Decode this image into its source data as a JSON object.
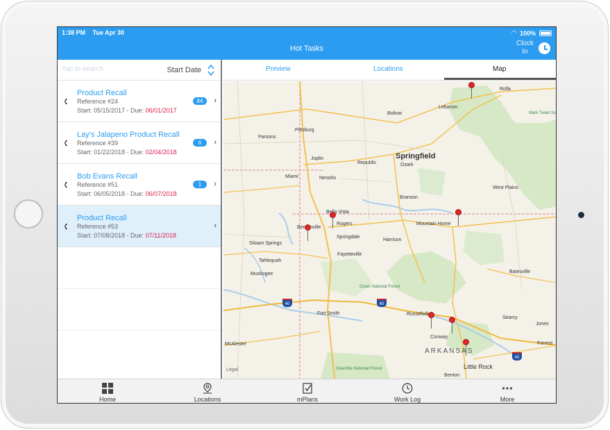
{
  "status_bar": {
    "time": "1:38 PM",
    "date": "Tue Apr 30",
    "battery": "100%"
  },
  "header": {
    "title": "Hot Tasks",
    "clock_in_line1": "Clock",
    "clock_in_line2": "In"
  },
  "search": {
    "placeholder": "Tap to search",
    "sort_label": "Start Date"
  },
  "tasks": [
    {
      "title": "Product Recall",
      "reference": "Reference #24",
      "start": "Start: 05/15/2017 - Due: ",
      "due": "06/01/2017",
      "badge": "84",
      "selected": false
    },
    {
      "title": "Lay's Jalapeno Product Recall",
      "reference": "Reference #39",
      "start": "Start: 01/22/2018 - Due: ",
      "due": "02/04/2018",
      "badge": "6",
      "selected": false
    },
    {
      "title": "Bob Evans Recall",
      "reference": "Reference #51",
      "start": "Start: 06/05/2018 - Due: ",
      "due": "06/07/2018",
      "badge": "1",
      "selected": false
    },
    {
      "title": "Product Recall",
      "reference": "Reference #53",
      "start": "Start: 07/08/2018 - Due: ",
      "due": "07/11/2018",
      "badge": "",
      "selected": true
    }
  ],
  "tabs": [
    {
      "label": "Preview",
      "active": false
    },
    {
      "label": "Locations",
      "active": false
    },
    {
      "label": "Map",
      "active": true
    }
  ],
  "map": {
    "cities": {
      "rolla": "Rolla",
      "lebanon": "Lebanon",
      "bolivar": "Bolivar",
      "pittsburg": "Pittsburg",
      "parsons": "Parsons",
      "joplin": "Joplin",
      "springfield": "Springfield",
      "republic": "Republic",
      "ozark": "Ozark",
      "miami": "Miami",
      "neosho": "Neosho",
      "west_plains": "West Plains",
      "branson": "Branson",
      "bella_vista": "Bella Vista",
      "bentonville": "Bentonville",
      "rogers": "Rogers",
      "mountain_home": "Mountain Home",
      "siloam_springs": "Siloam Springs",
      "springdale": "Springdale",
      "harrison": "Harrison",
      "tahlequah": "Tahlequah",
      "fayetteville": "Fayetteville",
      "muskogee": "Muskogee",
      "batesville": "Batesville",
      "fort_smith": "Fort Smith",
      "russellville": "Russellville",
      "searcy": "Searcy",
      "mcalester": "McAlester",
      "conway": "Conway",
      "forrest": "Forrest",
      "little_rock": "Little Rock",
      "benton": "Benton",
      "jones": "Jones"
    },
    "state_label": "ARKANSAS",
    "forest_ozark": "Ozark National Forest",
    "forest_mark_twain": "Mark Twain National Forest",
    "forest_ouachita": "Ouachita National Forest",
    "interstate_40a": "40",
    "interstate_40b": "40",
    "interstate_40c": "40",
    "legal": "Legal"
  },
  "bottom_tabs": [
    {
      "label": "Home",
      "icon": "grid-icon"
    },
    {
      "label": "Locations",
      "icon": "location-pin-icon"
    },
    {
      "label": "mPlans",
      "icon": "checklist-icon"
    },
    {
      "label": "Work Log",
      "icon": "clock-icon"
    },
    {
      "label": "More",
      "icon": "more-dots-icon"
    }
  ],
  "colors": {
    "accent": "#2b9cf0",
    "due": "#d9204d",
    "selected_row": "#dff0fb",
    "pin": "#e0262a"
  }
}
